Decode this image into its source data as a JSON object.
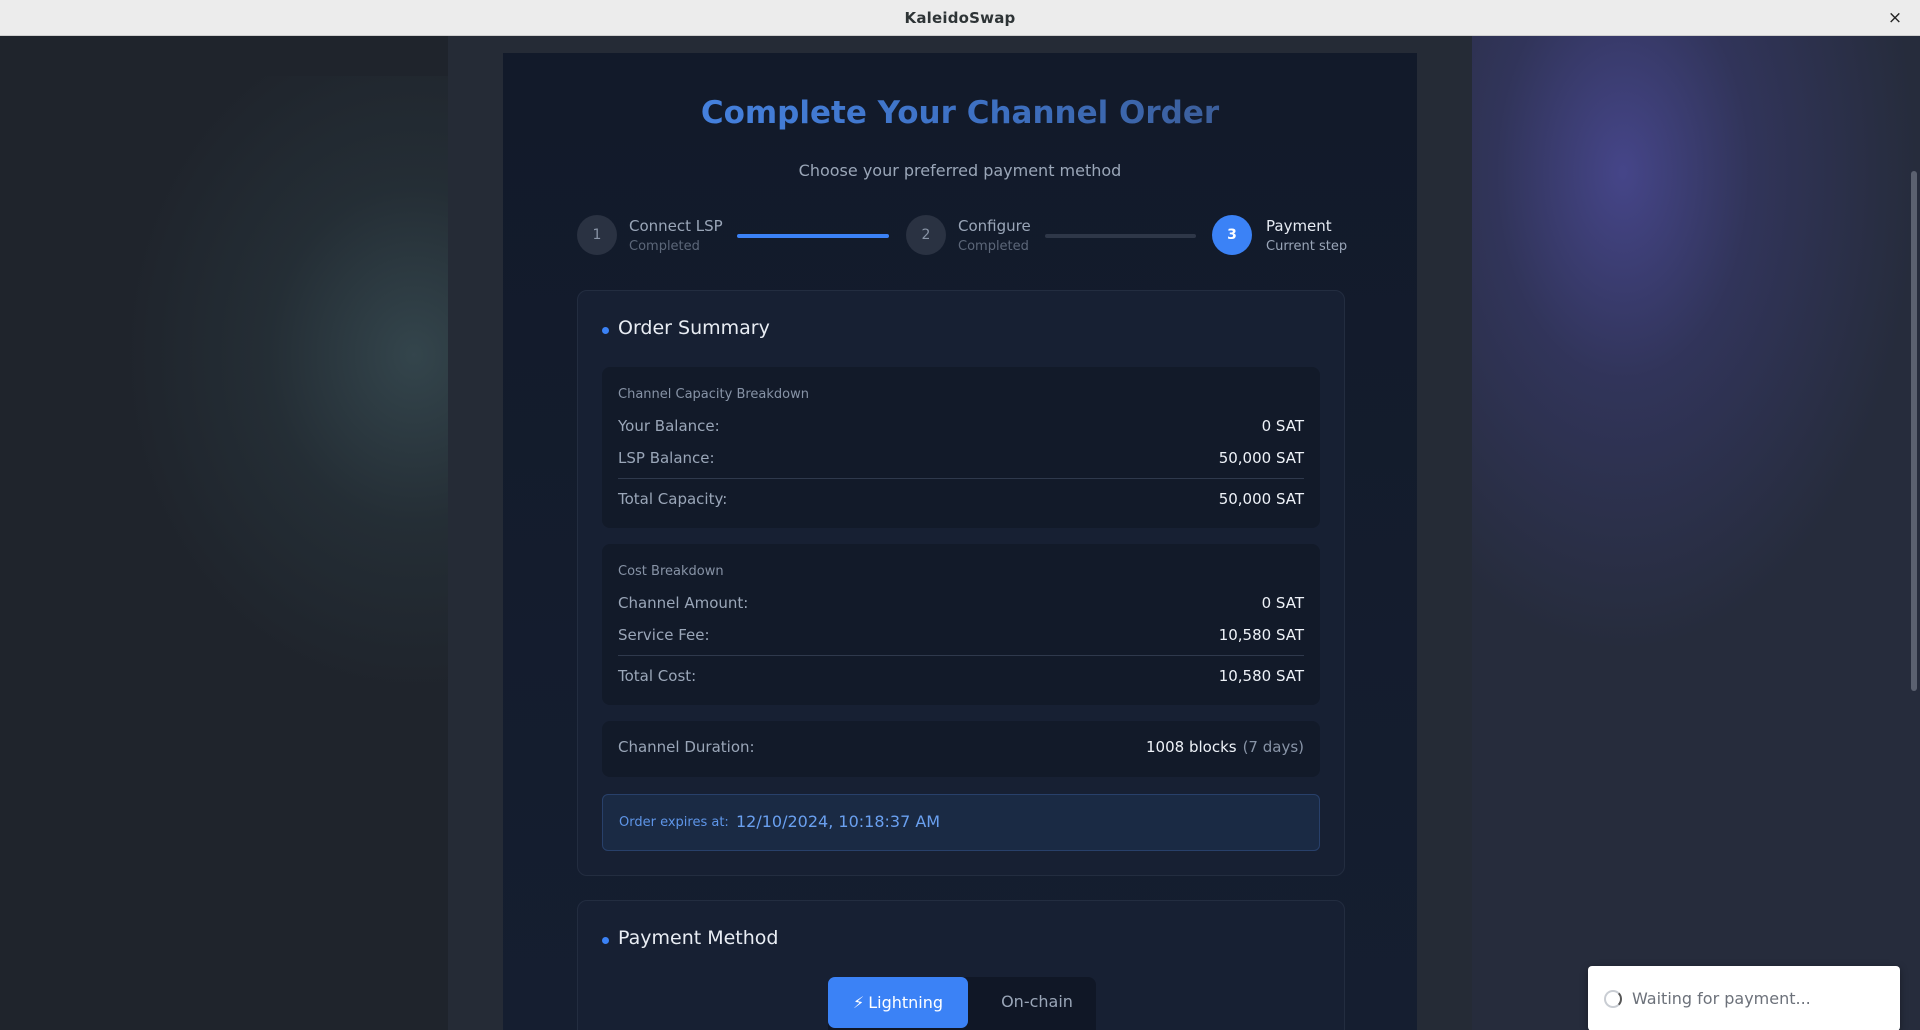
{
  "window": {
    "title": "KaleidoSwap",
    "close_icon": "×"
  },
  "header": {
    "title": "Complete Your Channel Order",
    "subtitle": "Choose your preferred payment method"
  },
  "steps": [
    {
      "number": "1",
      "label": "Connect LSP",
      "status": "Completed"
    },
    {
      "number": "2",
      "label": "Configure",
      "status": "Completed"
    },
    {
      "number": "3",
      "label": "Payment",
      "status": "Current step"
    }
  ],
  "order_summary": {
    "title": "Order Summary",
    "capacity": {
      "heading": "Channel Capacity Breakdown",
      "your_balance_label": "Your Balance:",
      "your_balance_value": "0 SAT",
      "lsp_balance_label": "LSP Balance:",
      "lsp_balance_value": "50,000 SAT",
      "total_label": "Total Capacity:",
      "total_value": "50,000 SAT"
    },
    "cost": {
      "heading": "Cost Breakdown",
      "channel_amount_label": "Channel Amount:",
      "channel_amount_value": "0 SAT",
      "service_fee_label": "Service Fee:",
      "service_fee_value": "10,580 SAT",
      "total_label": "Total Cost:",
      "total_value": "10,580 SAT"
    },
    "duration": {
      "label": "Channel Duration:",
      "blocks": "1008 blocks",
      "days": "(7 days)"
    },
    "expiry": {
      "label": "Order expires at:",
      "value": "12/10/2024, 10:18:37 AM"
    }
  },
  "payment_method": {
    "title": "Payment Method",
    "lightning_icon": "⚡",
    "lightning_label": "Lightning",
    "onchain_label": "On-chain",
    "selected": "Lightning"
  },
  "toast": {
    "message": "Waiting for payment..."
  },
  "colors": {
    "accent": "#3b82f6",
    "panel": "#121a2a",
    "card": "#172033"
  }
}
